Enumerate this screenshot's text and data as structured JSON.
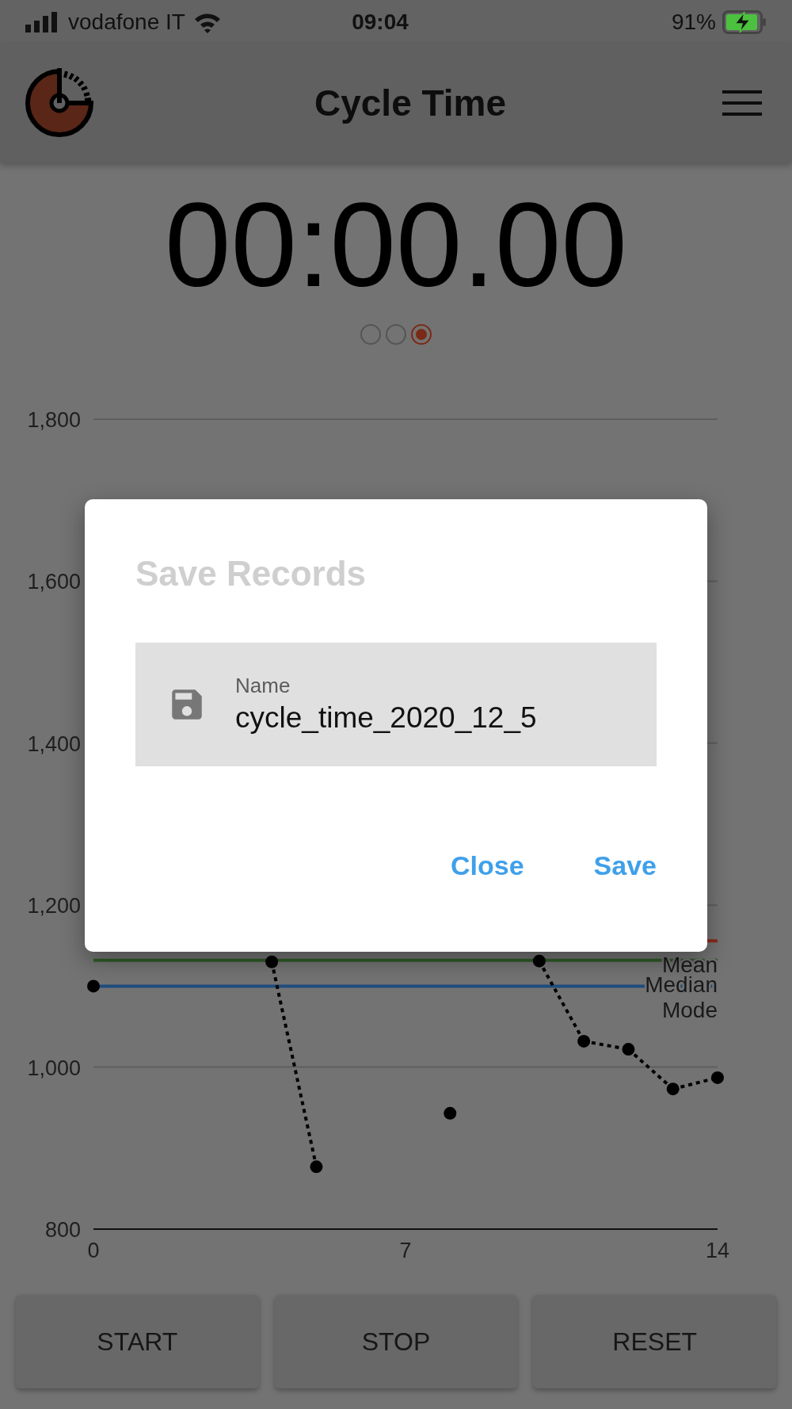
{
  "status_bar": {
    "carrier": "vodafone IT",
    "time": "09:04",
    "battery": "91%",
    "charging": true
  },
  "app_bar": {
    "title": "Cycle Time"
  },
  "timer": "00:00.00",
  "page_indicator": [
    {
      "selected": false
    },
    {
      "selected": false
    },
    {
      "selected": true
    }
  ],
  "chart": {
    "chart_data": {
      "type": "line",
      "x": [
        0,
        1,
        2,
        3,
        4,
        5,
        6,
        7,
        8,
        9,
        10,
        11,
        12,
        13,
        14
      ],
      "grid": true,
      "series": [
        {
          "color": "#000000",
          "line_style": "dotted",
          "marker": "circle",
          "values": [
            1100,
            null,
            null,
            null,
            1130,
            877,
            null,
            null,
            943,
            null,
            1131,
            1032,
            1022,
            973,
            987
          ]
        }
      ],
      "xlim": [
        0,
        14
      ],
      "ylim": [
        800,
        1800
      ],
      "xticks": [
        0,
        7,
        14
      ],
      "yticks": [
        {
          "value": 800,
          "label": "800"
        },
        {
          "value": 1000,
          "label": "1,000"
        },
        {
          "value": 1200,
          "label": "1,200"
        },
        {
          "value": 1400,
          "label": "1,400"
        },
        {
          "value": 1600,
          "label": "1,600"
        },
        {
          "value": 1800,
          "label": "1,800"
        }
      ],
      "ref_lines": [
        {
          "axis": "y",
          "value": 1156,
          "label": "Mean",
          "color": "#8a2b1c"
        },
        {
          "axis": "y",
          "value": 1132,
          "label": "Median",
          "color": "#2f5a27"
        },
        {
          "axis": "y",
          "value": 1100,
          "label": "Mode",
          "color": "#1f4d7e"
        }
      ]
    }
  },
  "buttons": [
    "START",
    "STOP",
    "RESET"
  ],
  "dialog": {
    "title": "Save Records",
    "field": {
      "label": "Name",
      "value": "cycle_time_2020_12_5"
    },
    "actions": [
      "Close",
      "Save"
    ]
  }
}
